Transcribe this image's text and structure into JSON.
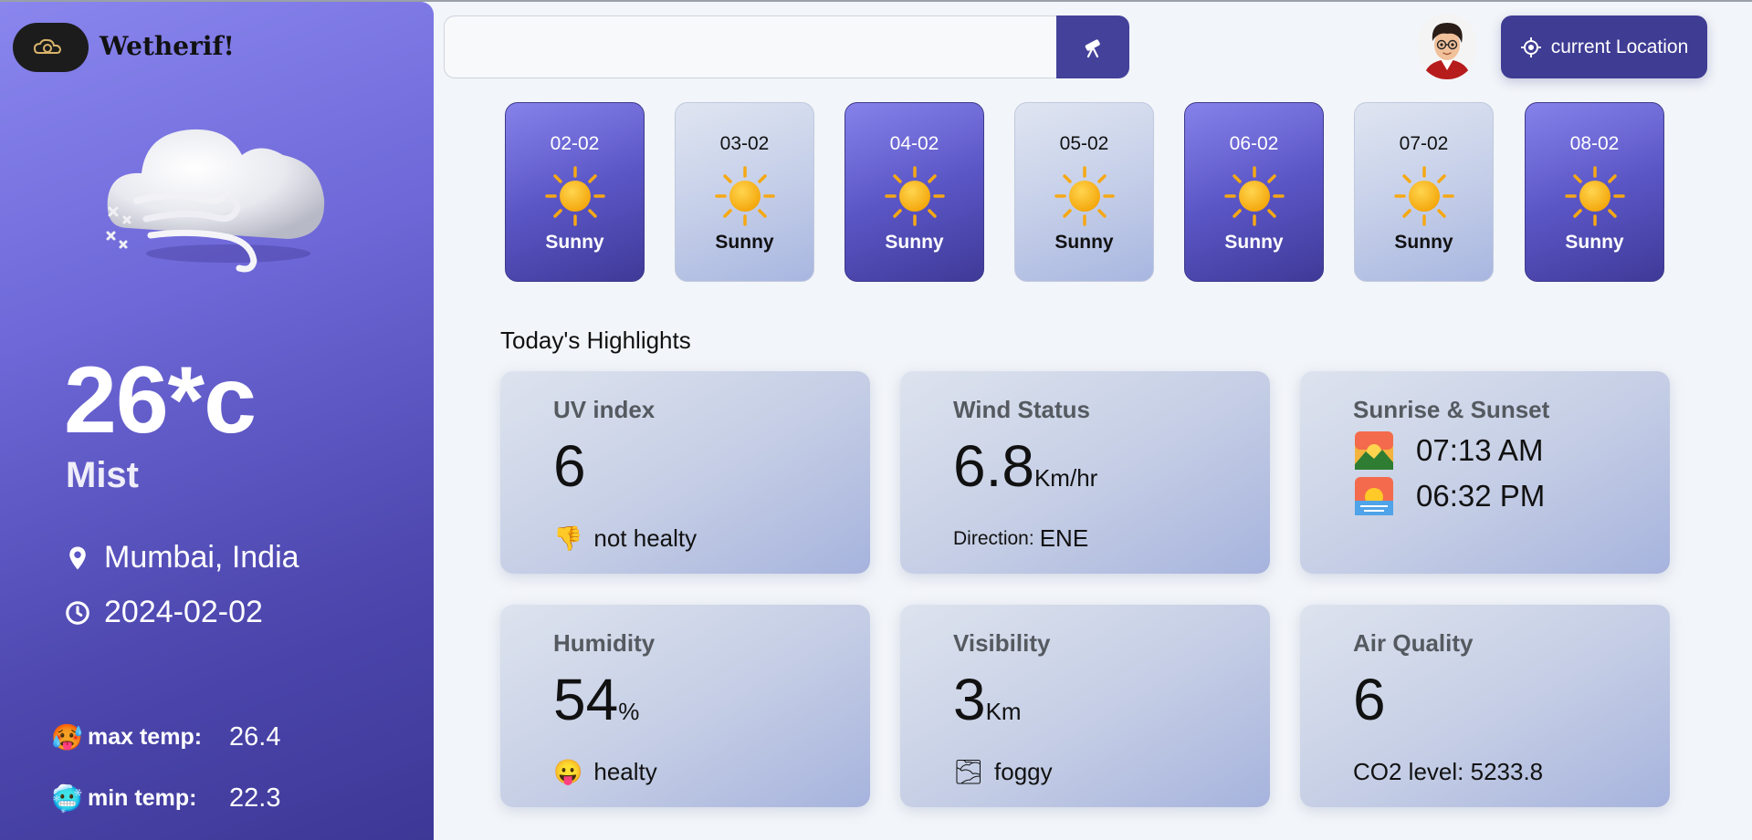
{
  "sidebar": {
    "brand": "Wetherif!",
    "temperature": "26*c",
    "condition": "Mist",
    "location": "Mumbai, India",
    "date": "2024-02-02",
    "max_label": "max temp:",
    "max_value": "26.4",
    "min_label": "min temp:",
    "min_value": "22.3"
  },
  "topbar": {
    "search_value": "",
    "location_button": "current Location"
  },
  "forecast": [
    {
      "date": "02-02",
      "condition": "Sunny"
    },
    {
      "date": "03-02",
      "condition": "Sunny"
    },
    {
      "date": "04-02",
      "condition": "Sunny"
    },
    {
      "date": "05-02",
      "condition": "Sunny"
    },
    {
      "date": "06-02",
      "condition": "Sunny"
    },
    {
      "date": "07-02",
      "condition": "Sunny"
    },
    {
      "date": "08-02",
      "condition": "Sunny"
    }
  ],
  "highlights": {
    "title": "Today's Highlights",
    "uv": {
      "title": "UV index",
      "value": "6",
      "note": "not healty",
      "note_emoji": "👎"
    },
    "wind": {
      "title": "Wind Status",
      "value": "6.8",
      "unit": "Km/hr",
      "dir_label": "Direction:",
      "dir_value": "ENE"
    },
    "sun": {
      "title": "Sunrise & Sunset",
      "sunrise": "07:13 AM",
      "sunset": "06:32 PM"
    },
    "humidity": {
      "title": "Humidity",
      "value": "54",
      "unit": "%",
      "note": "healty",
      "note_emoji": "😛"
    },
    "visibility": {
      "title": "Visibility",
      "value": "3",
      "unit": "Km",
      "note": "foggy",
      "note_emoji": "🌫"
    },
    "air": {
      "title": "Air Quality",
      "value": "6",
      "co2": "CO2 level: 5233.8"
    }
  },
  "colors": {
    "accent": "#44419a",
    "sidebar": "#5b56c6"
  }
}
